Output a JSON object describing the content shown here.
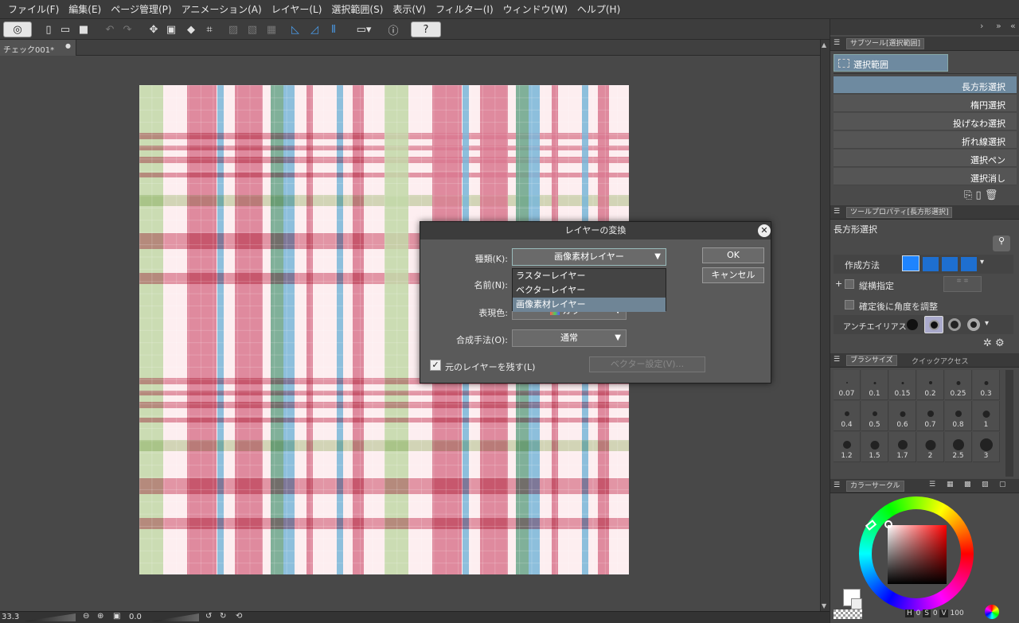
{
  "menubar": {
    "items": [
      "ファイル(F)",
      "編集(E)",
      "ページ管理(P)",
      "アニメーション(A)",
      "レイヤー(L)",
      "選択範囲(S)",
      "表示(V)",
      "フィルター(I)",
      "ウィンドウ(W)",
      "ヘルプ(H)"
    ]
  },
  "document": {
    "tab_label": "チェック001*"
  },
  "status": {
    "zoom": "33.3",
    "angle": "0.0"
  },
  "subtool_panel": {
    "title": "サブツール[選択範囲]",
    "group": "選択範囲",
    "items": [
      "長方形選択",
      "楕円選択",
      "投げなわ選択",
      "折れ線選択",
      "選択ペン",
      "選択消し"
    ],
    "selected": "長方形選択"
  },
  "tool_property": {
    "title": "ツールプロパティ[長方形選択]",
    "tool_name": "長方形選択",
    "mode_label": "作成方法",
    "aspect_label": "縦横指定",
    "adjust_angle_label": "確定後に角度を調整",
    "antialias_label": "アンチエイリアス"
  },
  "brush_size": {
    "tab_brush": "ブラシサイズ",
    "tab_quick": "クイックアクセス",
    "sizes": [
      "0.07",
      "0.1",
      "0.15",
      "0.2",
      "0.25",
      "0.3",
      "0.4",
      "0.5",
      "0.6",
      "0.7",
      "0.8",
      "1",
      "1.2",
      "1.5",
      "1.7",
      "2",
      "2.5",
      "3"
    ]
  },
  "color_panel": {
    "tab": "カラーサークル",
    "readout": {
      "h_label": "H",
      "h_value": "0",
      "s_label": "S",
      "s_value": "0",
      "v_label": "V",
      "v_value": "100"
    },
    "hue_accent": "#ff0000"
  },
  "dialog": {
    "title": "レイヤーの変換",
    "type_label": "種類(K):",
    "type_value": "画像素材レイヤー",
    "type_options": [
      "ラスターレイヤー",
      "ベクターレイヤー",
      "画像素材レイヤー"
    ],
    "name_label": "名前(N):",
    "color_label": "表現色:",
    "color_value": "カラー",
    "blend_label": "合成手法(O):",
    "blend_value": "通常",
    "keep_label": "元のレイヤーを残す(L)",
    "keep_checked": true,
    "vector_button": "ベクター設定(V)...",
    "ok": "OK",
    "cancel": "キャンセル"
  },
  "plaid_colors": {
    "pink": "#d9788f",
    "blue": "#79b6d8",
    "green": "#c2d8a8",
    "teal": "#6aa58a",
    "white": "#fdeef0"
  }
}
